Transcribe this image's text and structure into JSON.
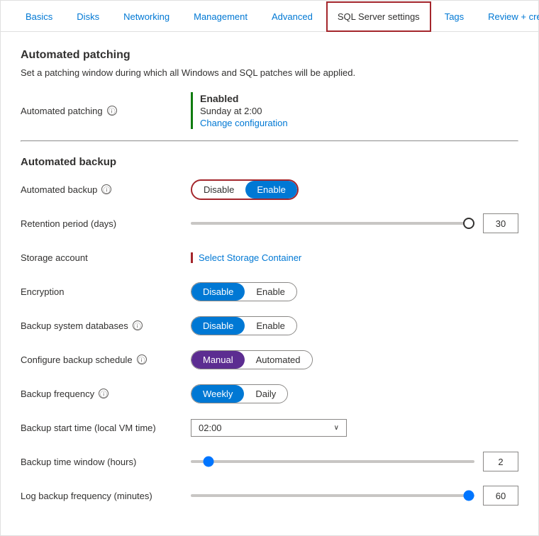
{
  "nav": {
    "tabs": [
      {
        "id": "basics",
        "label": "Basics",
        "active": false,
        "highlighted": false
      },
      {
        "id": "disks",
        "label": "Disks",
        "active": false,
        "highlighted": false
      },
      {
        "id": "networking",
        "label": "Networking",
        "active": false,
        "highlighted": false
      },
      {
        "id": "management",
        "label": "Management",
        "active": false,
        "highlighted": false
      },
      {
        "id": "advanced",
        "label": "Advanced",
        "active": false,
        "highlighted": false
      },
      {
        "id": "sql-server-settings",
        "label": "SQL Server settings",
        "active": true,
        "highlighted": true
      },
      {
        "id": "tags",
        "label": "Tags",
        "active": false,
        "highlighted": false
      },
      {
        "id": "review-create",
        "label": "Review + create",
        "active": false,
        "highlighted": false
      }
    ]
  },
  "automated_patching": {
    "section_title": "Automated patching",
    "section_desc": "Set a patching window during which all Windows and SQL patches will be applied.",
    "label": "Automated patching",
    "status_enabled": "Enabled",
    "status_time": "Sunday at 2:00",
    "change_link": "Change configuration"
  },
  "automated_backup": {
    "section_title": "Automated backup",
    "backup_label": "Automated backup",
    "disable_btn": "Disable",
    "enable_btn": "Enable",
    "retention_label": "Retention period (days)",
    "retention_value": "30",
    "storage_label": "Storage account",
    "storage_link": "Select Storage Container",
    "encryption_label": "Encryption",
    "enc_disable": "Disable",
    "enc_enable": "Enable",
    "backup_sys_label": "Backup system databases",
    "bsys_disable": "Disable",
    "bsys_enable": "Enable",
    "configure_label": "Configure backup schedule",
    "cfg_manual": "Manual",
    "cfg_automated": "Automated",
    "frequency_label": "Backup frequency",
    "freq_weekly": "Weekly",
    "freq_daily": "Daily",
    "start_time_label": "Backup start time (local VM time)",
    "start_time_value": "02:00",
    "time_window_label": "Backup time window (hours)",
    "time_window_value": "2",
    "log_frequency_label": "Log backup frequency (minutes)",
    "log_frequency_value": "60"
  },
  "icons": {
    "info": "ⓘ",
    "chevron_down": "∨"
  }
}
